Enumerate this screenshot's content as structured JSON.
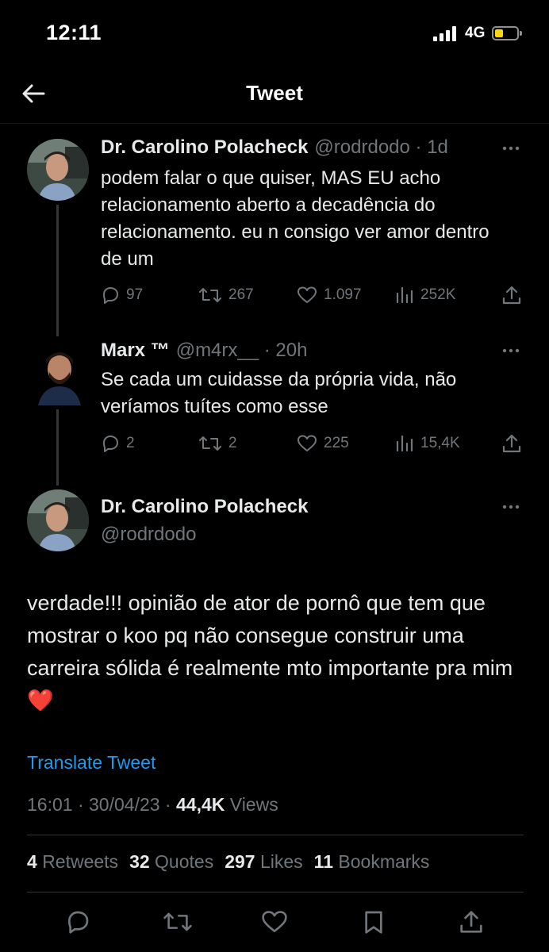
{
  "status_bar": {
    "time": "12:11",
    "network": "4G"
  },
  "header": {
    "title": "Tweet"
  },
  "tweets": [
    {
      "name": "Dr. Carolino Polacheck",
      "handle": "@rodrdodo",
      "time": "1d",
      "text": "podem falar o que quiser, MAS EU acho relacionamento aberto a decadência do relacionamento. eu n consigo ver amor dentro de um",
      "replies": "97",
      "retweets": "267",
      "likes": "1.097",
      "views": "252K"
    },
    {
      "name": "Marx ™",
      "handle": "@m4rx__",
      "time": "20h",
      "text": "Se cada um cuidasse da própria vida, não veríamos tuítes como esse",
      "replies": "2",
      "retweets": "2",
      "likes": "225",
      "views": "15,4K"
    }
  ],
  "main_tweet": {
    "name": "Dr. Carolino Polacheck",
    "handle": "@rodrdodo",
    "text": "verdade!!! opinião de ator de pornô que tem que mostrar o koo pq não consegue construir uma carreira sólida é realmente mto importante pra mim",
    "emoji": "❤️",
    "translate_label": "Translate Tweet",
    "time": "16:01",
    "date": "30/04/23",
    "views_count": "44,4K",
    "views_label": "Views",
    "stats": {
      "retweets_count": "4",
      "retweets_label": "Retweets",
      "quotes_count": "32",
      "quotes_label": "Quotes",
      "likes_count": "297",
      "likes_label": "Likes",
      "bookmarks_count": "11",
      "bookmarks_label": "Bookmarks"
    }
  },
  "icons": [
    "back-arrow-icon",
    "reply-icon",
    "retweet-icon",
    "like-icon",
    "views-icon",
    "share-icon",
    "bookmark-icon",
    "more-icon",
    "signal-icon",
    "battery-icon"
  ],
  "colors": {
    "background": "#000000",
    "text": "#e7e9ea",
    "muted": "#71767b",
    "link": "#1d9bf0",
    "battery": "#ffd60a"
  }
}
